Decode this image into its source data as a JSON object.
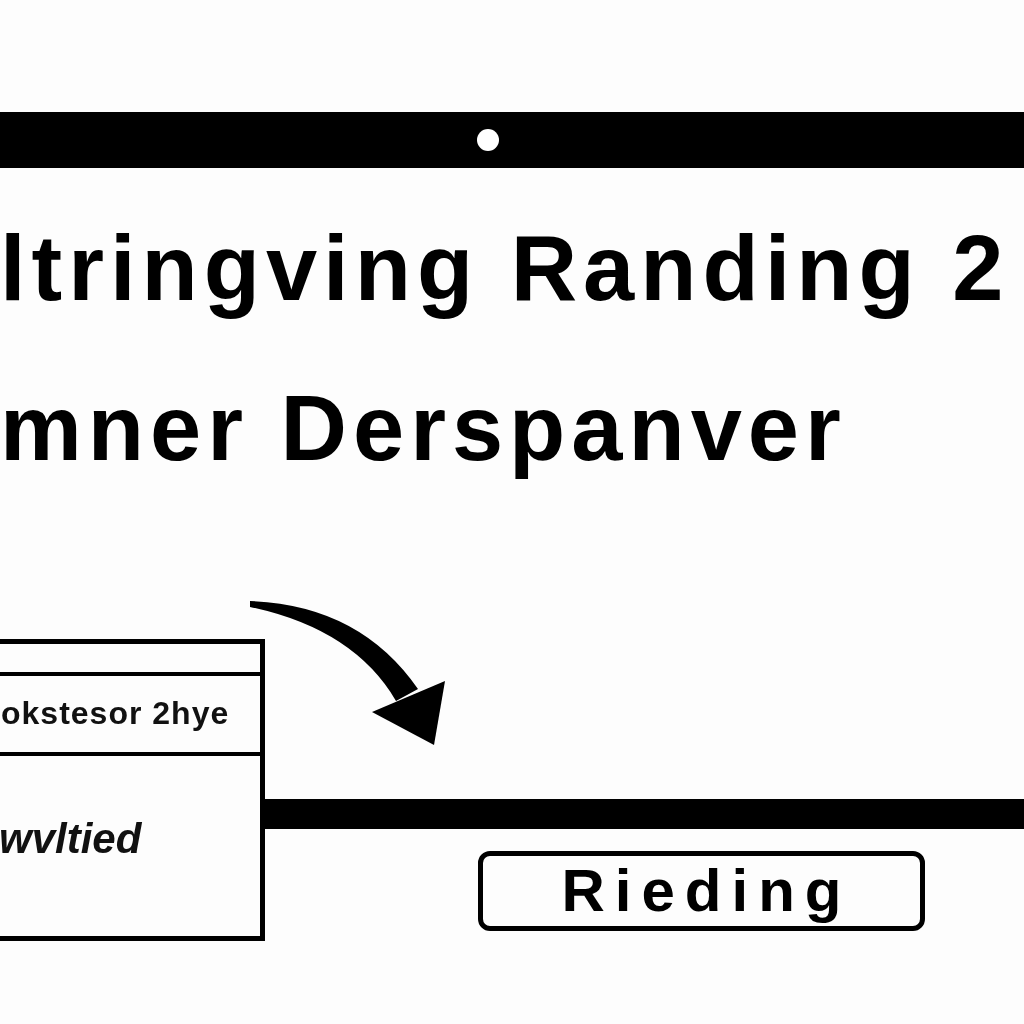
{
  "heading": [
    "ltringving Randing 2",
    "mner Derspanver"
  ],
  "panel": {
    "row_text": "okstesor 2hye",
    "body_text": "wvltied"
  },
  "button": {
    "label": "Rieding"
  }
}
